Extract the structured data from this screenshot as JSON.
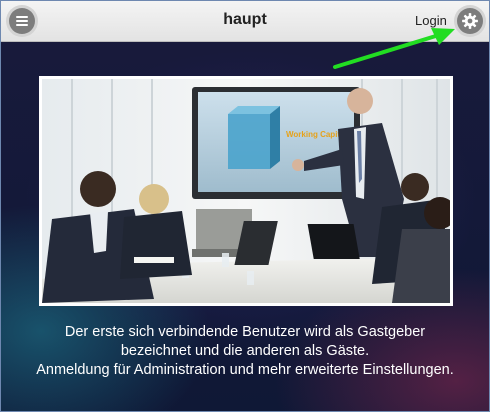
{
  "header": {
    "title": "haupt",
    "login_label": "Login",
    "menu_icon": "hamburger-menu-icon",
    "settings_icon": "gear-icon"
  },
  "annotation": {
    "arrow_color": "#22dd22"
  },
  "hero_image": {
    "screen_text": "Working Capital"
  },
  "caption": {
    "line1": "Der erste sich verbindende Benutzer wird als Gastgeber",
    "line2": "bezeichnet und die anderen als Gäste.",
    "line3": "Anmeldung für Administration und mehr erweiterte Einstellungen."
  }
}
